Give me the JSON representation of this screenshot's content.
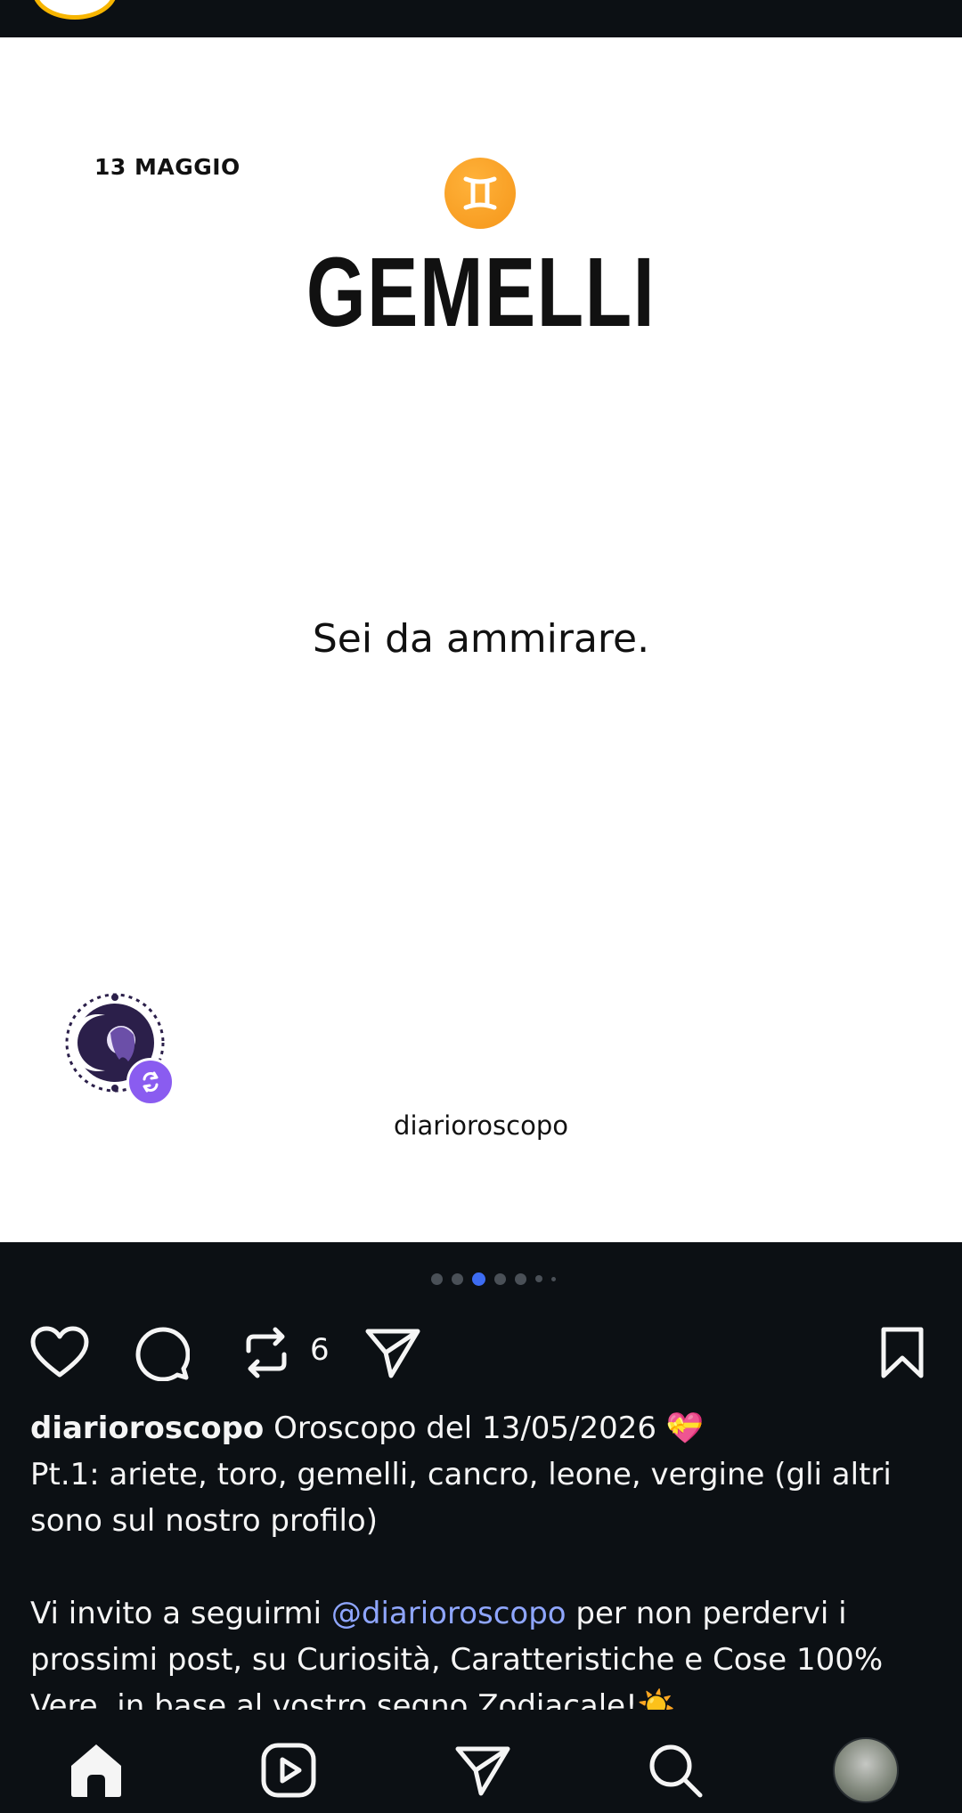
{
  "post": {
    "date_label": "13 MAGGIO",
    "sign_title": "GEMELLI",
    "quote": "Sei da ammirare.",
    "brand_name": "diarioroscopo"
  },
  "carousel": {
    "total_dots": 7,
    "active_index": 2
  },
  "actions": {
    "repost_count": "6"
  },
  "caption": {
    "username": "diarioroscopo",
    "line1_text": " Oroscopo del 13/05/2026 💝",
    "line2": "Pt.1: ariete, toro, gemelli, cancro, leone, vergine (gli altri sono sul nostro profilo)",
    "line3_before": "Vi invito a seguirmi ",
    "mention": "@diarioroscopo",
    "line3_after": " per non perdervi i prossimi post, su Curiosità, Caratteristiche e Cose 100% Vere, in base al vostro segno Zodiacale!☀️"
  },
  "colors": {
    "accent_blue": "#3d6cf2",
    "mention": "#8fa6ff",
    "repost_badge": "#8a5cf0",
    "sign_orange": "#f5961a"
  },
  "icons": [
    "heart-icon",
    "comment-icon",
    "repost-icon",
    "share-icon",
    "bookmark-icon",
    "home-icon",
    "reels-icon",
    "direct-icon",
    "search-icon",
    "profile-avatar"
  ]
}
